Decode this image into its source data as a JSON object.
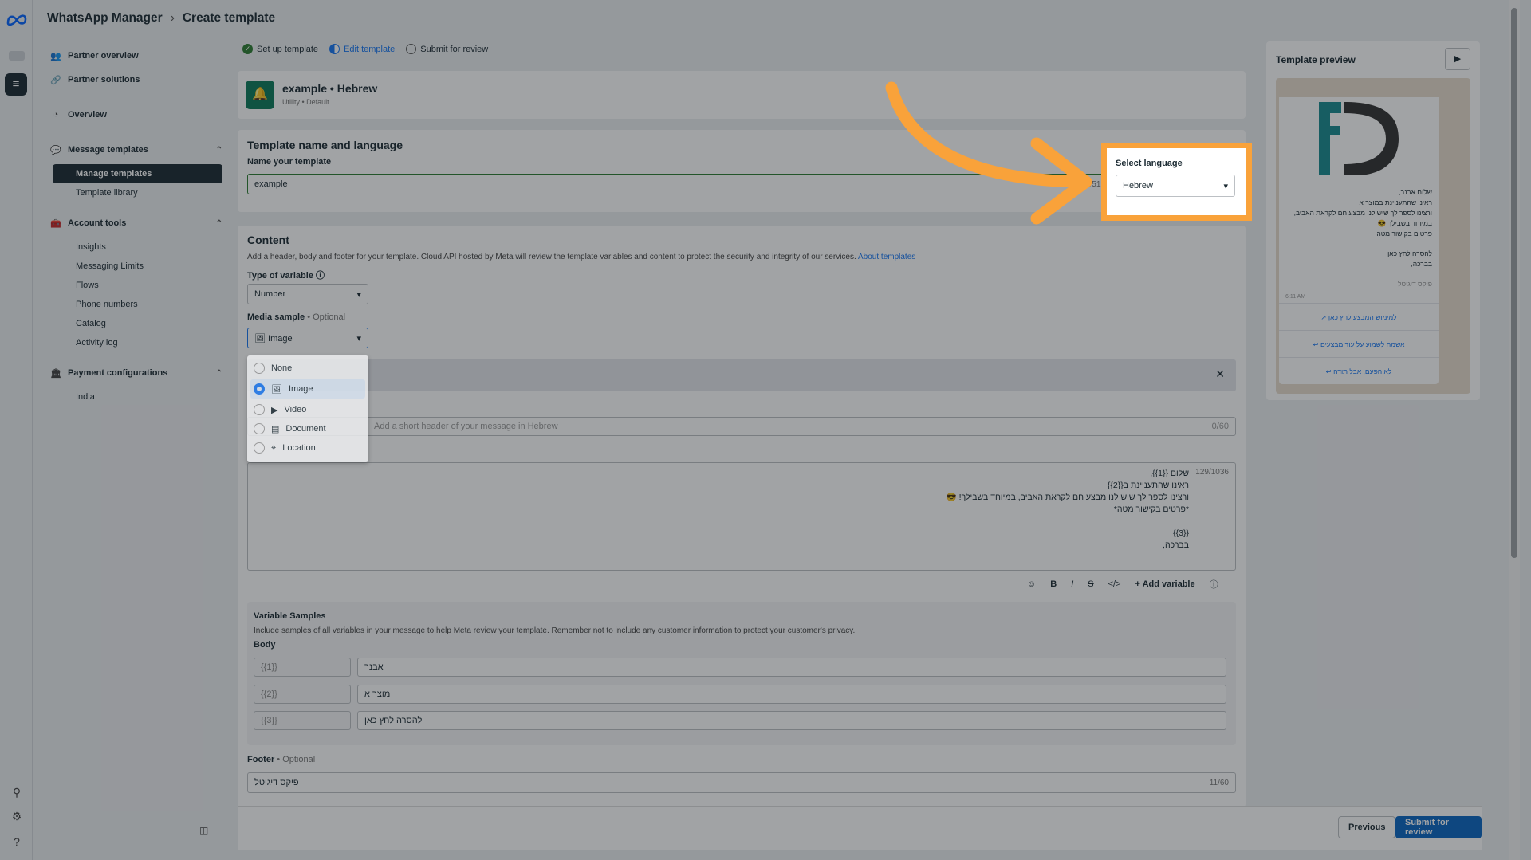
{
  "header": {
    "app_title": "WhatsApp Manager",
    "page_title": "Create template"
  },
  "sidebar": {
    "partner_overview": "Partner overview",
    "partner_solutions": "Partner solutions",
    "overview": "Overview",
    "message_templates": "Message templates",
    "manage_templates": "Manage templates",
    "template_library": "Template library",
    "account_tools": "Account tools",
    "insights": "Insights",
    "messaging_limits": "Messaging Limits",
    "flows": "Flows",
    "phone_numbers": "Phone numbers",
    "catalog": "Catalog",
    "activity_log": "Activity log",
    "payment_configurations": "Payment configurations",
    "india": "India"
  },
  "stepper": {
    "step1": "Set up template",
    "step2": "Edit template",
    "step3": "Submit for review"
  },
  "summary": {
    "name": "example • Hebrew",
    "meta": "Utility  • Default"
  },
  "name_section": {
    "heading": "Template name and language",
    "name_label": "Name your template",
    "name_value": "example",
    "name_count": "7/512",
    "language_label": "Select language",
    "language_value": "Hebrew"
  },
  "content": {
    "heading": "Content",
    "description": "Add a header, body and footer for your template. Cloud API hosted by Meta will review the template variables and content to protect the security and integrity of our services.",
    "about_link": "About templates",
    "variable_type_label": "Type of variable",
    "variable_type_value": "Number",
    "media_label": "Media sample",
    "optional": "• Optional",
    "media_value": "Image",
    "media_options": {
      "none": "None",
      "image": "Image",
      "video": "Video",
      "document": "Document",
      "location": "Location"
    },
    "header_placeholder": "Add a short header of your message in Hebrew",
    "header_count": "0/60",
    "body_lines": {
      "l1": "שלום {{1}},",
      "l2": "ראינו שהתעניינת ב{{2}}",
      "l3": "ורצינו לספר לך שיש לנו מבצע חם לקראת האביב, במיוחד בשבילך! 😎",
      "l4": "*פרטים בקישור מטה*",
      "l5": "{{3}}",
      "l6": "בברכה,"
    },
    "body_count": "129/1036",
    "add_variable": "Add variable",
    "variable_samples_heading": "Variable Samples",
    "variable_samples_desc": "Include samples of all variables in your message to help Meta review your template. Remember not to include any customer information to protect your customer's privacy.",
    "body_label": "Body",
    "var1_key": "{{1}}",
    "var1_value": "אבנר",
    "var2_key": "{{2}}",
    "var2_value": "מוצר א",
    "var3_key": "{{3}}",
    "var3_value": "להסרה לחץ כאן",
    "footer_label": "Footer",
    "footer_value": "פיקס דיגיטל",
    "footer_count": "11/60"
  },
  "actions": {
    "previous": "Previous",
    "submit": "Submit for review"
  },
  "preview": {
    "title": "Template preview",
    "msg_l1": "שלום אבנר,",
    "msg_l2": "ראינו שהתעניינת במוצר א",
    "msg_l3": "ורצינו לספר לך שיש לנו מבצע חם לקראת האביב,",
    "msg_l4": "במיוחד בשבילך 😎",
    "msg_l5": "פרטים בקישור מטה",
    "msg_l6": "להסרה לחץ כאן",
    "msg_l7": "בברכה,",
    "footer": "פיקס דיגיטל",
    "time": "6:11 AM",
    "btn1": "למימוש המבצע לחץ כאן",
    "btn2": "אשמח לשמוע על עוד מבצעים",
    "btn3": "לא הפעם, אבל תודה"
  },
  "colors": {
    "accent": "#1877f2",
    "highlight": "#f9a23a",
    "primary_button": "#0a66c2",
    "whatsapp_green": "#0d7a5a"
  }
}
